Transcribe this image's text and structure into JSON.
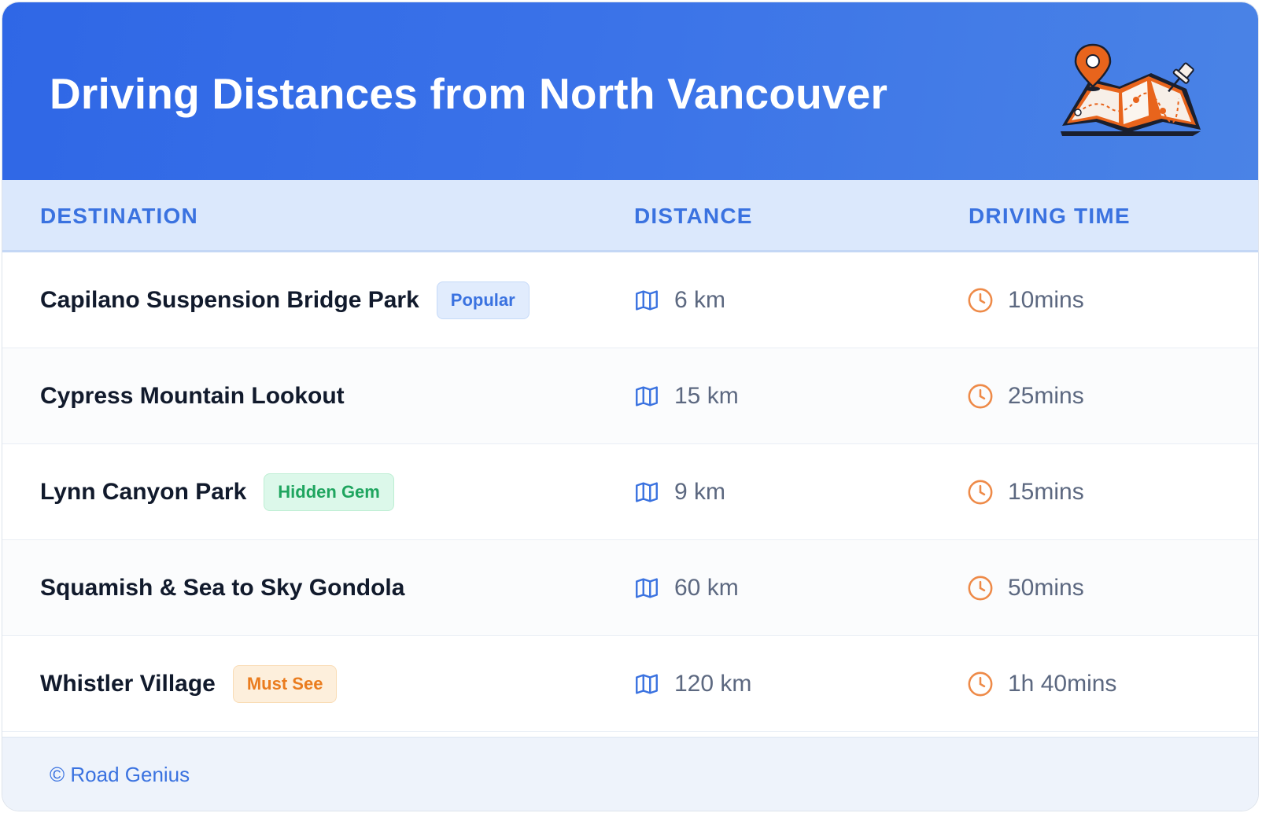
{
  "header": {
    "title": "Driving Distances from North Vancouver"
  },
  "columns": {
    "destination": "DESTINATION",
    "distance": "DISTANCE",
    "driving_time": "DRIVING TIME"
  },
  "rows": [
    {
      "destination": "Capilano Suspension Bridge Park",
      "badge": "Popular",
      "badge_color": "#3a72e0",
      "distance": "6 km",
      "time": "10mins"
    },
    {
      "destination": "Cypress Mountain Lookout",
      "badge": "",
      "distance": "15 km",
      "time": "25mins"
    },
    {
      "destination": "Lynn Canyon Park",
      "badge": "Hidden Gem",
      "badge_color": "#1fa55f",
      "distance": "9 km",
      "time": "15mins"
    },
    {
      "destination": "Squamish & Sea to Sky Gondola",
      "badge": "",
      "distance": "60 km",
      "time": "50mins"
    },
    {
      "destination": "Whistler Village",
      "badge": "Must See",
      "badge_color": "#ea7c1e",
      "distance": "120 km",
      "time": "1h 40mins"
    }
  ],
  "icons": {
    "distance": "map-icon",
    "time": "clock-icon",
    "header_illustration": "map-pin-illustration"
  },
  "colors": {
    "header_bg": "#3a72e8",
    "accent": "#3a72e0",
    "clock": "#ee8a48"
  },
  "footer": {
    "text": "© Road Genius"
  }
}
